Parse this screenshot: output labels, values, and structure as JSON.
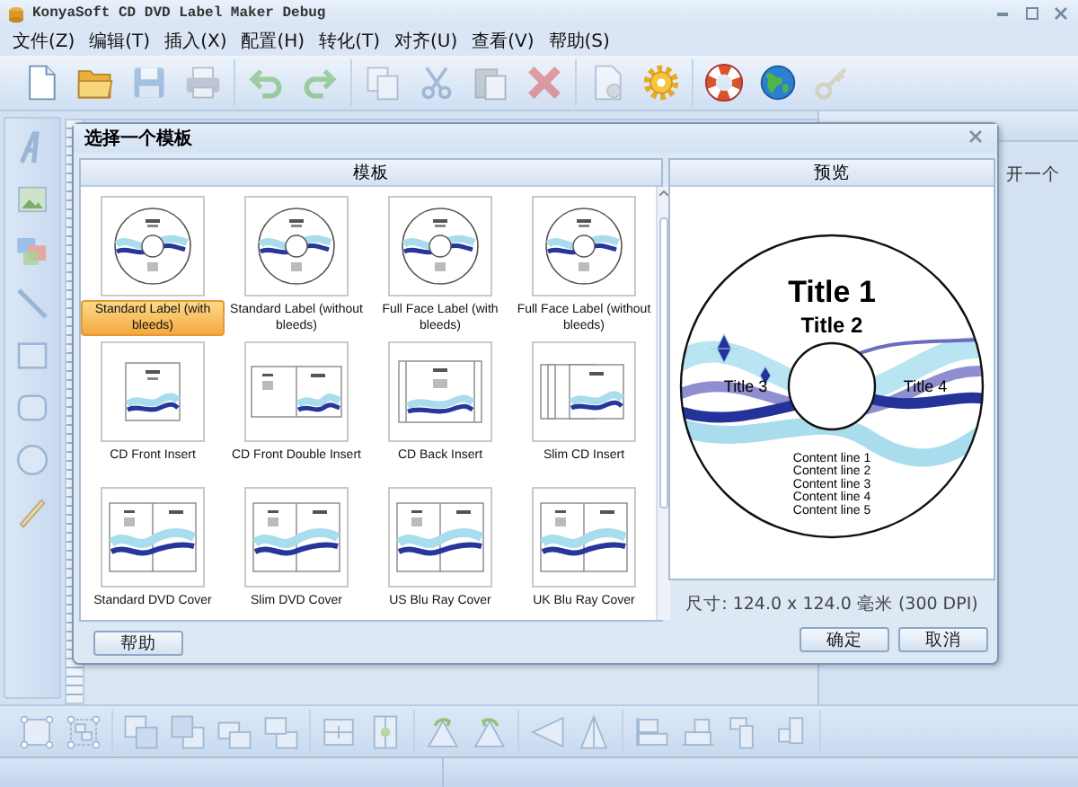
{
  "window": {
    "title": "KonyaSoft CD DVD Label Maker Debug"
  },
  "menu": [
    {
      "label": "文件(Z)"
    },
    {
      "label": "编辑(T)"
    },
    {
      "label": "插入(X)"
    },
    {
      "label": "配置(H)"
    },
    {
      "label": "转化(T)"
    },
    {
      "label": "对齐(U)"
    },
    {
      "label": "查看(V)"
    },
    {
      "label": "帮助(S)"
    }
  ],
  "toolbar": [
    [
      {
        "kind": "new",
        "disabled": false
      },
      {
        "kind": "open",
        "disabled": false
      },
      {
        "kind": "save",
        "disabled": true
      },
      {
        "kind": "print",
        "disabled": true
      }
    ],
    [
      {
        "kind": "undo",
        "disabled": true
      },
      {
        "kind": "redo",
        "disabled": true
      }
    ],
    [
      {
        "kind": "copy",
        "disabled": true
      },
      {
        "kind": "cut",
        "disabled": true
      },
      {
        "kind": "paste",
        "disabled": true
      },
      {
        "kind": "delete",
        "disabled": true
      }
    ],
    [
      {
        "kind": "page",
        "disabled": true
      },
      {
        "kind": "settings",
        "disabled": false
      }
    ],
    [
      {
        "kind": "help",
        "disabled": false
      },
      {
        "kind": "web",
        "disabled": false
      },
      {
        "kind": "key",
        "disabled": true
      }
    ]
  ],
  "tools": [
    {
      "kind": "text"
    },
    {
      "kind": "image"
    },
    {
      "kind": "layers"
    },
    {
      "kind": "line"
    },
    {
      "kind": "rect"
    },
    {
      "kind": "roundrect"
    },
    {
      "kind": "ellipse"
    },
    {
      "kind": "pen"
    }
  ],
  "side_panel": {
    "text": "开一个"
  },
  "dialog": {
    "title": "选择一个模板",
    "templates_header": "模板",
    "preview_header": "预览",
    "templates": [
      {
        "label": "Standard Label (with bleeds)",
        "kind": "disc",
        "selected": true
      },
      {
        "label": "Standard Label (without bleeds)",
        "kind": "disc",
        "selected": false
      },
      {
        "label": "Full Face Label (with bleeds)",
        "kind": "disc",
        "selected": false
      },
      {
        "label": "Full Face Label (without bleeds)",
        "kind": "disc",
        "selected": false
      },
      {
        "label": "CD Front Insert",
        "kind": "insert",
        "selected": false
      },
      {
        "label": "CD Front Double Insert",
        "kind": "double",
        "selected": false
      },
      {
        "label": "CD Back Insert",
        "kind": "back",
        "selected": false
      },
      {
        "label": "Slim CD Insert",
        "kind": "slim",
        "selected": false
      },
      {
        "label": "Standard DVD Cover",
        "kind": "cover",
        "selected": false
      },
      {
        "label": "Slim DVD Cover",
        "kind": "cover",
        "selected": false
      },
      {
        "label": "US Blu Ray Cover",
        "kind": "cover",
        "selected": false
      },
      {
        "label": "UK Blu Ray Cover",
        "kind": "cover",
        "selected": false
      }
    ],
    "preview": {
      "title_1": "Title 1",
      "title_2": "Title 2",
      "title_3": "Title 3",
      "title_4": "Title 4",
      "content_lines": [
        "Content line 1",
        "Content line 2",
        "Content line 3",
        "Content line 4",
        "Content line 5"
      ]
    },
    "size": "尺寸: 124.0 x 124.0 毫米 (300 DPI)",
    "help_button": "帮助",
    "ok_button": "确定",
    "cancel_button": "取消"
  },
  "bottom_toolbar": [
    [
      {
        "kind": "select"
      },
      {
        "kind": "group"
      }
    ],
    [
      {
        "kind": "front"
      },
      {
        "kind": "back"
      },
      {
        "kind": "forward"
      },
      {
        "kind": "backward"
      }
    ],
    [
      {
        "kind": "center-h"
      },
      {
        "kind": "center-v"
      }
    ],
    [
      {
        "kind": "rotate-l"
      },
      {
        "kind": "rotate-r"
      }
    ],
    [
      {
        "kind": "flip-h"
      },
      {
        "kind": "flip-v"
      }
    ],
    [
      {
        "kind": "align-top"
      },
      {
        "kind": "align-bottom"
      },
      {
        "kind": "align-left"
      },
      {
        "kind": "align-right"
      }
    ]
  ]
}
